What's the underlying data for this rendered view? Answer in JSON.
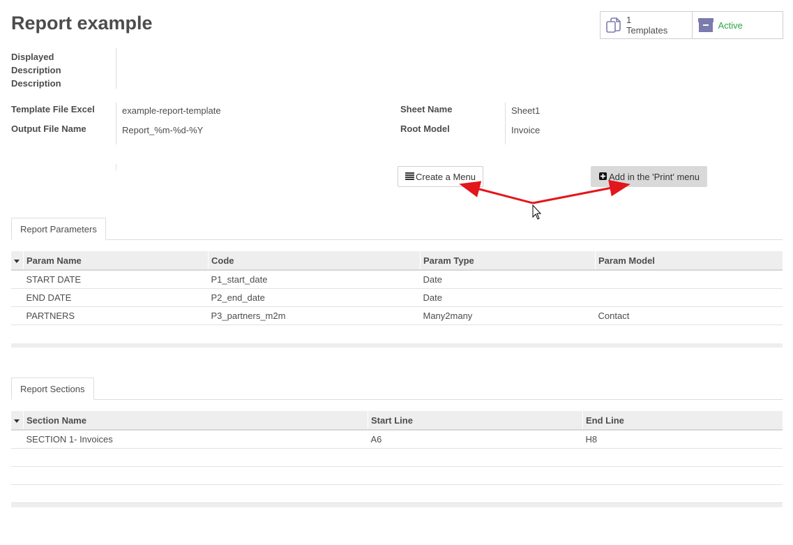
{
  "page": {
    "title": "Report example"
  },
  "smart_buttons": {
    "templates_count": "1",
    "templates_label": "Templates",
    "active_label": "Active",
    "colors": {
      "active": "#28a745",
      "icon": "#7c7bad"
    }
  },
  "fields": {
    "displayed_description_line1": "Displayed",
    "displayed_description_line2": "Description",
    "displayed_description_line3": "Description",
    "template_file_label": "Template File Excel",
    "template_file_value": "example-report-template",
    "output_file_label": "Output File Name",
    "output_file_value": "Report_%m-%d-%Y",
    "sheet_name_label": "Sheet Name",
    "sheet_name_value": "Sheet1",
    "root_model_label": "Root Model",
    "root_model_value": "Invoice"
  },
  "actions": {
    "create_menu_label": "Create a Menu",
    "add_print_label": "Add in the 'Print' menu"
  },
  "parameters": {
    "tab_label": "Report Parameters",
    "headers": [
      "Param Name",
      "Code",
      "Param Type",
      "Param Model"
    ],
    "rows": [
      [
        "START DATE",
        "P1_start_date",
        "Date",
        ""
      ],
      [
        "END DATE",
        "P2_end_date",
        "Date",
        ""
      ],
      [
        "PARTNERS",
        "P3_partners_m2m",
        "Many2many",
        "Contact"
      ]
    ]
  },
  "sections": {
    "tab_label": "Report Sections",
    "headers": [
      "Section Name",
      "Start Line",
      "End Line"
    ],
    "rows": [
      [
        "SECTION 1- Invoices",
        "A6",
        "H8"
      ]
    ]
  },
  "annotation": {
    "arrow_color": "#e3161b"
  }
}
